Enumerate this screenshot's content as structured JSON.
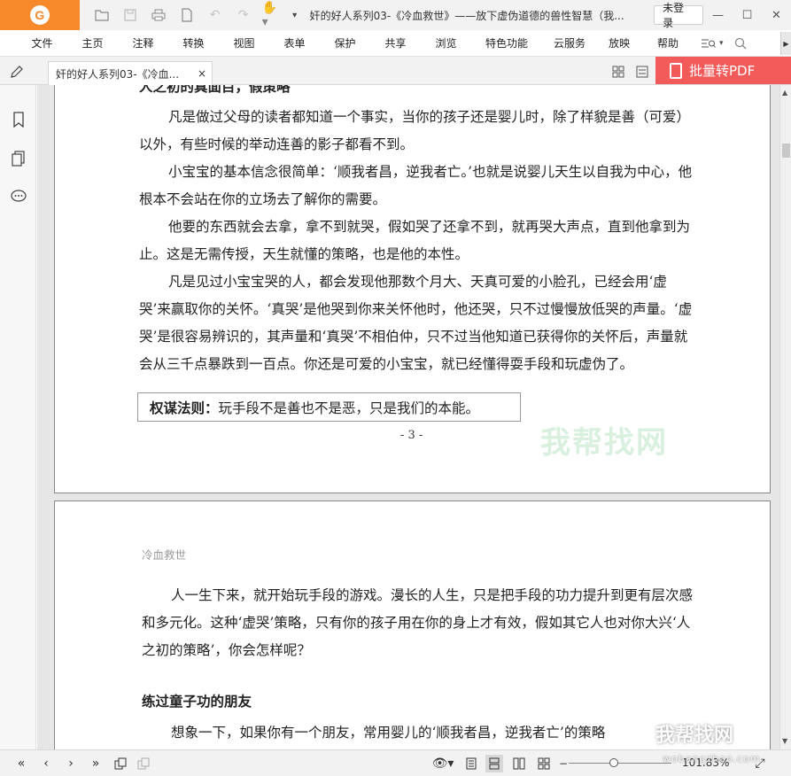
{
  "app": {
    "title": "奸的好人系列03-《冷血救世》——放下虚伪道德的兽性智慧（我...",
    "login_label": "未登录",
    "accent_color": "#f7892b"
  },
  "menu": {
    "items": [
      "文件",
      "主页",
      "注释",
      "转换",
      "视图",
      "表单",
      "保护",
      "共享",
      "浏览",
      "特色功能",
      "云服务",
      "放映",
      "帮助"
    ]
  },
  "tab": {
    "label": "奸的好人系列03-《冷血...",
    "close_symbol": "×"
  },
  "batch_button": {
    "label": "批量转PDF",
    "color": "#f35b5b"
  },
  "page1": {
    "heading_cut": "人之初的真面目，假策略",
    "paragraphs": [
      "凡是做过父母的读者都知道一个事实，当你的孩子还是婴儿时，除了样貌是善（可爱）以外，有些时候的举动连善的影子都看不到。",
      "小宝宝的基本信念很简单：‘顺我者昌，逆我者亡。’也就是说婴儿天生以自我为中心，他根本不会站在你的立场去了解你的需要。",
      "他要的东西就会去拿，拿不到就哭，假如哭了还拿不到，就再哭大声点，直到他拿到为止。这是无需传授，天生就懂的策略，也是他的本性。",
      "凡是见过小宝宝哭的人，都会发现他那数个月大、天真可爱的小脸孔，已经会用‘虚哭’来赢取你的关怀。‘真哭’是他哭到你来关怀他时，他还哭，只不过慢慢放低哭的声量。‘虚哭’是很容易辨识的，其声量和‘真哭’不相伯仲，只不过当他知道已获得你的关怀后，声量就会从三千点暴跌到一百点。你还是可爱的小宝宝，就已经懂得耍手段和玩虚伪了。"
    ],
    "rule_label": "权谋法则：",
    "rule_text": "玩手段不是善也不是恶，只是我们的本能。",
    "page_number": "- 3 -",
    "watermark": "我帮找网"
  },
  "page2": {
    "running_head": "冷血救世",
    "paragraph": "人一生下来，就开始玩手段的游戏。漫长的人生，只是把手段的功力提升到更有层次感和多元化。这种‘虚哭’策略，只有你的孩子用在你的身上才有效，假如其它人也对你大兴‘人之初的策略’，你会怎样呢？",
    "heading": "练过童子功的朋友",
    "last_line": "想象一下，如果你有一个朋友，常用婴儿的‘顺我者昌，逆我者亡’的策略"
  },
  "status": {
    "zoom": "101.83%",
    "zoom_fraction": 0.44
  },
  "overlay_watermark": {
    "text": "我帮找网",
    "sub": "wobangzhao.com"
  }
}
